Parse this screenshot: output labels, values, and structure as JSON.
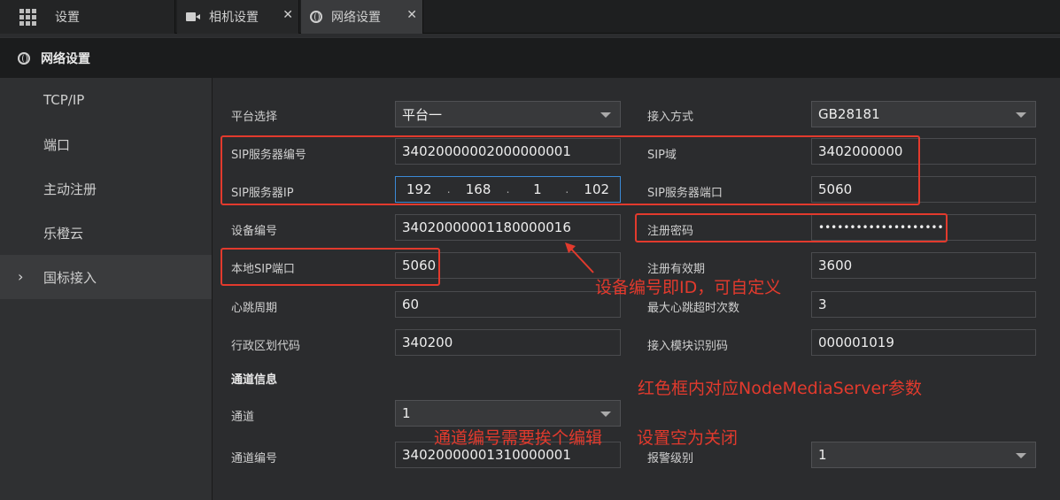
{
  "tabs": {
    "home_label": "设置",
    "camera_label": "相机设置",
    "network_label": "网络设置",
    "close_glyph": "✕"
  },
  "header": {
    "title": "网络设置"
  },
  "sidebar": {
    "items": [
      {
        "label": "TCP/IP"
      },
      {
        "label": "端口"
      },
      {
        "label": "主动注册"
      },
      {
        "label": "乐橙云"
      },
      {
        "label": "国标接入"
      }
    ],
    "active_chevron": "›"
  },
  "form": {
    "platform_label": "平台选择",
    "platform_value": "平台一",
    "access_label": "接入方式",
    "access_value": "GB28181",
    "sip_server_id_label": "SIP服务器编号",
    "sip_server_id_value": "34020000002000000001",
    "sip_domain_label": "SIP域",
    "sip_domain_value": "3402000000",
    "sip_server_ip_label": "SIP服务器IP",
    "sip_server_ip": [
      "192",
      "168",
      "1",
      "102"
    ],
    "sip_server_port_label": "SIP服务器端口",
    "sip_server_port_value": "5060",
    "device_id_label": "设备编号",
    "device_id_value": "34020000001180000016",
    "reg_password_label": "注册密码",
    "reg_password_value": "••••••••••••••••••••",
    "local_sip_port_label": "本地SIP端口",
    "local_sip_port_value": "5060",
    "reg_validity_label": "注册有效期",
    "reg_validity_value": "3600",
    "heartbeat_label": "心跳周期",
    "heartbeat_value": "60",
    "max_heartbeat_label": "最大心跳超时次数",
    "max_heartbeat_value": "3",
    "region_code_label": "行政区划代码",
    "region_code_value": "340200",
    "module_id_label": "接入模块识别码",
    "module_id_value": "000001019",
    "channel_section_title": "通道信息",
    "channel_label": "通道",
    "channel_value": "1",
    "channel_id_label": "通道编号",
    "channel_id_value": "34020000001310000001",
    "alarm_level_label": "报警级别",
    "alarm_level_value": "1"
  },
  "annotations": {
    "device_id_note": "设备编号即ID，可自定义",
    "red_box_note": "红色框内对应NodeMediaServer参数",
    "channel_note": "通道编号需要挨个编辑",
    "empty_note": "设置空为关闭",
    "color": "#e23a2d"
  }
}
